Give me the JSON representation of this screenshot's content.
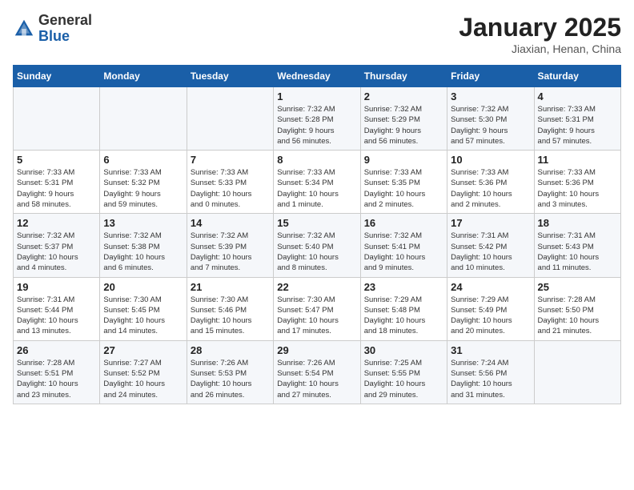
{
  "header": {
    "logo_general": "General",
    "logo_blue": "Blue",
    "month": "January 2025",
    "location": "Jiaxian, Henan, China"
  },
  "days_of_week": [
    "Sunday",
    "Monday",
    "Tuesday",
    "Wednesday",
    "Thursday",
    "Friday",
    "Saturday"
  ],
  "weeks": [
    [
      {
        "day": "",
        "info": ""
      },
      {
        "day": "",
        "info": ""
      },
      {
        "day": "",
        "info": ""
      },
      {
        "day": "1",
        "info": "Sunrise: 7:32 AM\nSunset: 5:28 PM\nDaylight: 9 hours\nand 56 minutes."
      },
      {
        "day": "2",
        "info": "Sunrise: 7:32 AM\nSunset: 5:29 PM\nDaylight: 9 hours\nand 56 minutes."
      },
      {
        "day": "3",
        "info": "Sunrise: 7:32 AM\nSunset: 5:30 PM\nDaylight: 9 hours\nand 57 minutes."
      },
      {
        "day": "4",
        "info": "Sunrise: 7:33 AM\nSunset: 5:31 PM\nDaylight: 9 hours\nand 57 minutes."
      }
    ],
    [
      {
        "day": "5",
        "info": "Sunrise: 7:33 AM\nSunset: 5:31 PM\nDaylight: 9 hours\nand 58 minutes."
      },
      {
        "day": "6",
        "info": "Sunrise: 7:33 AM\nSunset: 5:32 PM\nDaylight: 9 hours\nand 59 minutes."
      },
      {
        "day": "7",
        "info": "Sunrise: 7:33 AM\nSunset: 5:33 PM\nDaylight: 10 hours\nand 0 minutes."
      },
      {
        "day": "8",
        "info": "Sunrise: 7:33 AM\nSunset: 5:34 PM\nDaylight: 10 hours\nand 1 minute."
      },
      {
        "day": "9",
        "info": "Sunrise: 7:33 AM\nSunset: 5:35 PM\nDaylight: 10 hours\nand 2 minutes."
      },
      {
        "day": "10",
        "info": "Sunrise: 7:33 AM\nSunset: 5:36 PM\nDaylight: 10 hours\nand 2 minutes."
      },
      {
        "day": "11",
        "info": "Sunrise: 7:33 AM\nSunset: 5:36 PM\nDaylight: 10 hours\nand 3 minutes."
      }
    ],
    [
      {
        "day": "12",
        "info": "Sunrise: 7:32 AM\nSunset: 5:37 PM\nDaylight: 10 hours\nand 4 minutes."
      },
      {
        "day": "13",
        "info": "Sunrise: 7:32 AM\nSunset: 5:38 PM\nDaylight: 10 hours\nand 6 minutes."
      },
      {
        "day": "14",
        "info": "Sunrise: 7:32 AM\nSunset: 5:39 PM\nDaylight: 10 hours\nand 7 minutes."
      },
      {
        "day": "15",
        "info": "Sunrise: 7:32 AM\nSunset: 5:40 PM\nDaylight: 10 hours\nand 8 minutes."
      },
      {
        "day": "16",
        "info": "Sunrise: 7:32 AM\nSunset: 5:41 PM\nDaylight: 10 hours\nand 9 minutes."
      },
      {
        "day": "17",
        "info": "Sunrise: 7:31 AM\nSunset: 5:42 PM\nDaylight: 10 hours\nand 10 minutes."
      },
      {
        "day": "18",
        "info": "Sunrise: 7:31 AM\nSunset: 5:43 PM\nDaylight: 10 hours\nand 11 minutes."
      }
    ],
    [
      {
        "day": "19",
        "info": "Sunrise: 7:31 AM\nSunset: 5:44 PM\nDaylight: 10 hours\nand 13 minutes."
      },
      {
        "day": "20",
        "info": "Sunrise: 7:30 AM\nSunset: 5:45 PM\nDaylight: 10 hours\nand 14 minutes."
      },
      {
        "day": "21",
        "info": "Sunrise: 7:30 AM\nSunset: 5:46 PM\nDaylight: 10 hours\nand 15 minutes."
      },
      {
        "day": "22",
        "info": "Sunrise: 7:30 AM\nSunset: 5:47 PM\nDaylight: 10 hours\nand 17 minutes."
      },
      {
        "day": "23",
        "info": "Sunrise: 7:29 AM\nSunset: 5:48 PM\nDaylight: 10 hours\nand 18 minutes."
      },
      {
        "day": "24",
        "info": "Sunrise: 7:29 AM\nSunset: 5:49 PM\nDaylight: 10 hours\nand 20 minutes."
      },
      {
        "day": "25",
        "info": "Sunrise: 7:28 AM\nSunset: 5:50 PM\nDaylight: 10 hours\nand 21 minutes."
      }
    ],
    [
      {
        "day": "26",
        "info": "Sunrise: 7:28 AM\nSunset: 5:51 PM\nDaylight: 10 hours\nand 23 minutes."
      },
      {
        "day": "27",
        "info": "Sunrise: 7:27 AM\nSunset: 5:52 PM\nDaylight: 10 hours\nand 24 minutes."
      },
      {
        "day": "28",
        "info": "Sunrise: 7:26 AM\nSunset: 5:53 PM\nDaylight: 10 hours\nand 26 minutes."
      },
      {
        "day": "29",
        "info": "Sunrise: 7:26 AM\nSunset: 5:54 PM\nDaylight: 10 hours\nand 27 minutes."
      },
      {
        "day": "30",
        "info": "Sunrise: 7:25 AM\nSunset: 5:55 PM\nDaylight: 10 hours\nand 29 minutes."
      },
      {
        "day": "31",
        "info": "Sunrise: 7:24 AM\nSunset: 5:56 PM\nDaylight: 10 hours\nand 31 minutes."
      },
      {
        "day": "",
        "info": ""
      }
    ]
  ]
}
